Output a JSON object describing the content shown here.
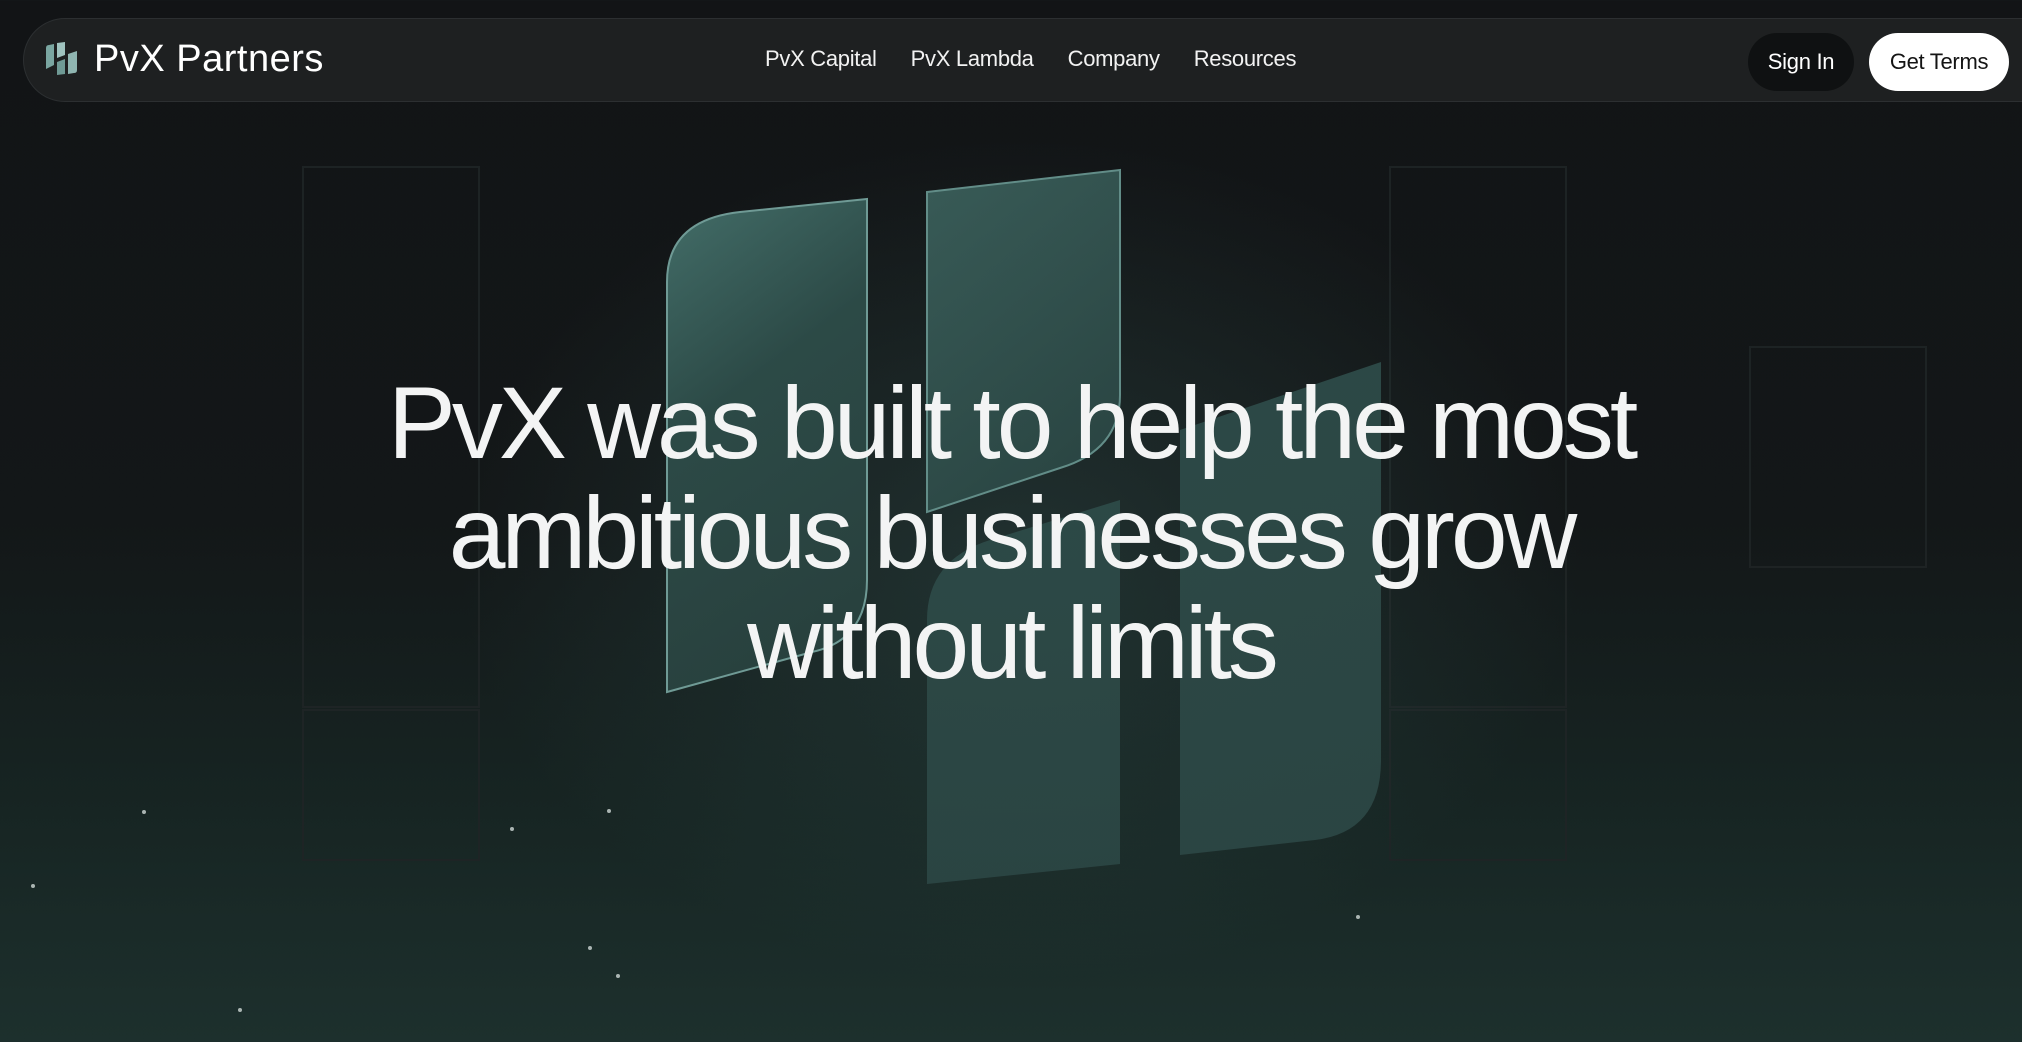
{
  "brand": {
    "name": "PvX Partners",
    "logo_icon": "pvx-bars-logo-icon"
  },
  "nav": {
    "links": [
      "PvX Capital",
      "PvX Lambda",
      "Company",
      "Resources"
    ]
  },
  "actions": {
    "sign_in": "Sign In",
    "get_terms": "Get Terms"
  },
  "hero": {
    "heading": "PvX was built to help the most ambitious businesses grow without limits",
    "graphic_icon": "pvx-logo-glass-graphic"
  },
  "colors": {
    "accent": "#4d7c77",
    "panel_dark": "#2b4644",
    "background": "#121416",
    "button_light": "#ffffff"
  }
}
